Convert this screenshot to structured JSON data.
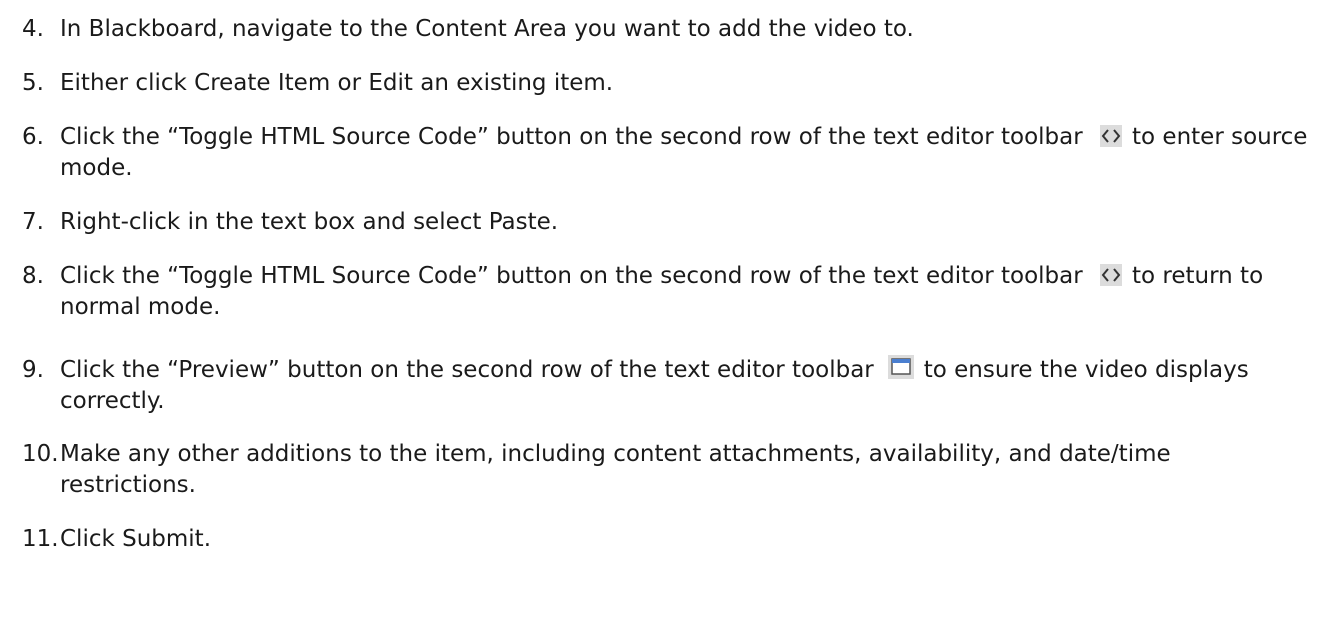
{
  "steps": [
    {
      "num": "4.",
      "text": "In Blackboard, navigate to the Content Area you want to add the video to."
    },
    {
      "num": "5.",
      "text": "Either click Create Item or Edit an existing item."
    },
    {
      "num": "6.",
      "text_before": "Click the “Toggle HTML Source Code” button on the second row of the text editor toolbar",
      "icon": "source-code-icon",
      "text_after": "to enter source mode."
    },
    {
      "num": "7.",
      "text": "Right-click in the text box and select Paste."
    },
    {
      "num": "8.",
      "text_before": "Click the “Toggle HTML Source Code” button on the second row of the text editor toolbar",
      "icon": "source-code-icon",
      "text_after": "to return to normal mode."
    },
    {
      "num": "9.",
      "text_before": "Click the “Preview” button on the second row of the text editor toolbar",
      "icon": "preview-window-icon",
      "text_after": "to ensure the video displays correctly."
    },
    {
      "num": "10.",
      "text": "Make any other additions to the item, including content attachments, availability, and date/time restrictions."
    },
    {
      "num": "11.",
      "text": "Click Submit."
    }
  ],
  "colors": {
    "text": "#1a1a1a",
    "icon_fill": "#dcdcdc",
    "icon_stroke": "#555555",
    "preview_blue": "#4a7fd0"
  }
}
